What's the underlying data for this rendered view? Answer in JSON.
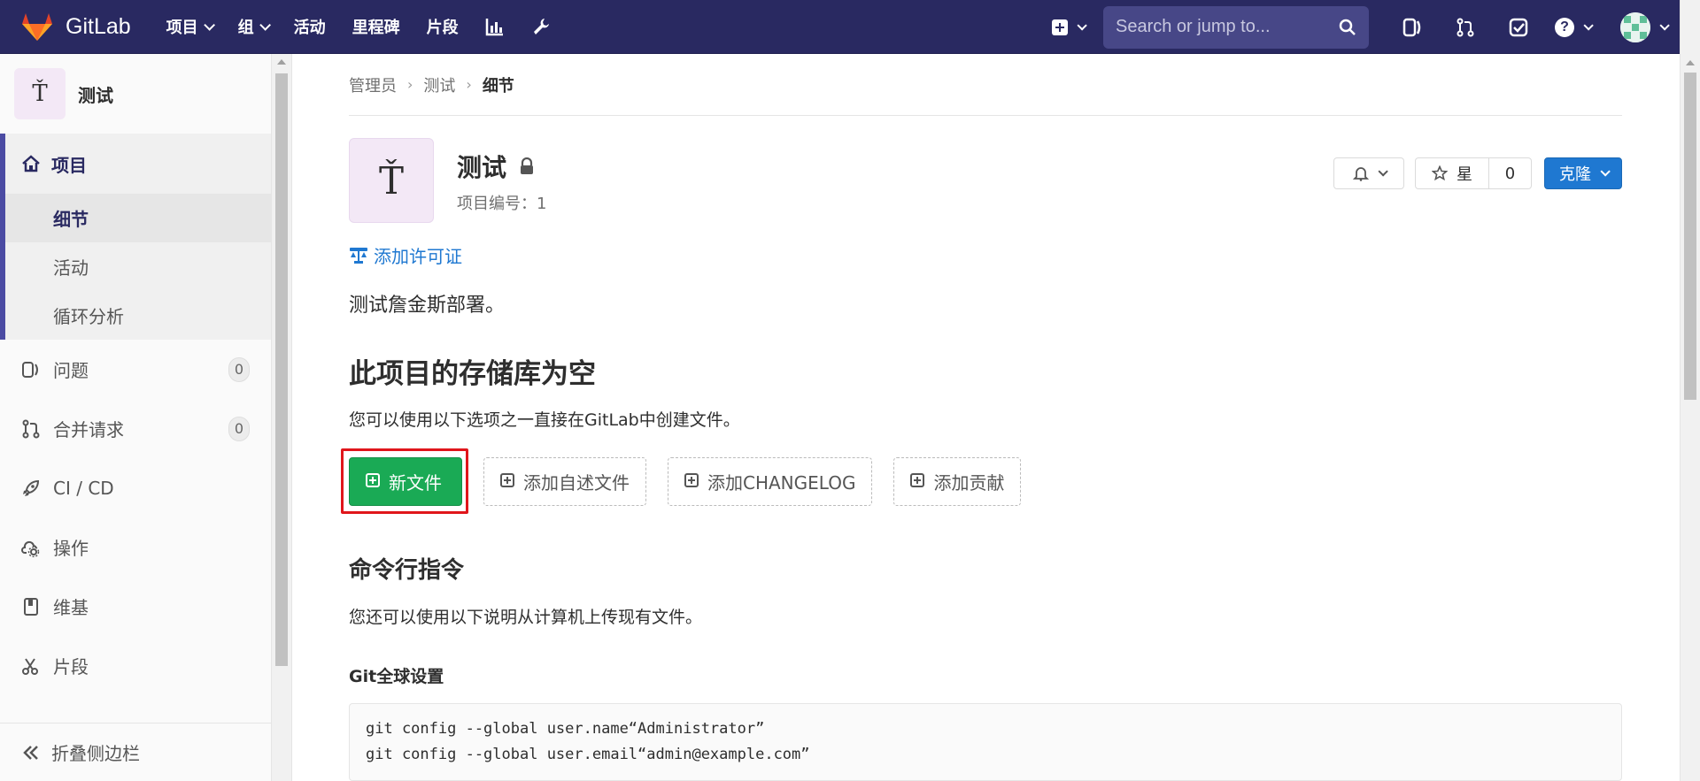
{
  "navbar": {
    "brand": "GitLab",
    "menu": [
      {
        "label": "项目",
        "dropdown": true
      },
      {
        "label": "组",
        "dropdown": true
      },
      {
        "label": "活动",
        "dropdown": false
      },
      {
        "label": "里程碑",
        "dropdown": false
      },
      {
        "label": "片段",
        "dropdown": false
      }
    ],
    "search_placeholder": "Search or jump to...",
    "icons": [
      "chart-icon",
      "wrench-icon",
      "plus-square-icon",
      "issues-icon",
      "merge-request-icon",
      "todo-check-icon",
      "help-icon",
      "avatar-icon"
    ],
    "help_glyph": "?"
  },
  "sidebar": {
    "project_avatar": "Ť",
    "project_name": "测试",
    "section_label": "项目",
    "sub_items": [
      {
        "label": "细节",
        "active": true
      },
      {
        "label": "活动",
        "active": false
      },
      {
        "label": "循环分析",
        "active": false
      }
    ],
    "items": [
      {
        "label": "问题",
        "icon": "issues-icon",
        "count": "0"
      },
      {
        "label": "合并请求",
        "icon": "merge-request-icon",
        "count": "0"
      },
      {
        "label": "CI / CD",
        "icon": "rocket-icon"
      },
      {
        "label": "操作",
        "icon": "cloud-gear-icon"
      },
      {
        "label": "维基",
        "icon": "book-icon"
      },
      {
        "label": "片段",
        "icon": "scissors-icon"
      }
    ],
    "collapse_label": "折叠侧边栏"
  },
  "breadcrumb": [
    "管理员",
    "测试",
    "细节"
  ],
  "project": {
    "avatar": "Ť",
    "name": "测试",
    "id_text": "项目编号：1",
    "star_label": "星",
    "star_count": "0",
    "clone_label": "克隆",
    "license_link": "添加许可证",
    "description": "测试詹金斯部署。"
  },
  "empty_repo": {
    "title": "此项目的存储库为空",
    "subtitle": "您可以使用以下选项之一直接在GitLab中创建文件。",
    "buttons": [
      "新文件",
      "添加自述文件",
      "添加CHANGELOG",
      "添加贡献"
    ]
  },
  "cli": {
    "title": "命令行指令",
    "subtitle": "您还可以使用以下说明从计算机上传现有文件。",
    "git_global_title": "Git全球设置",
    "code_lines": [
      "git config --global user.name“Administrator”",
      "git config --global user.email“admin@example.com”"
    ]
  },
  "colors": {
    "navbar": "#292961",
    "accent": "#1f78d1",
    "success": "#1aaa55",
    "highlight": "#e0161b"
  }
}
